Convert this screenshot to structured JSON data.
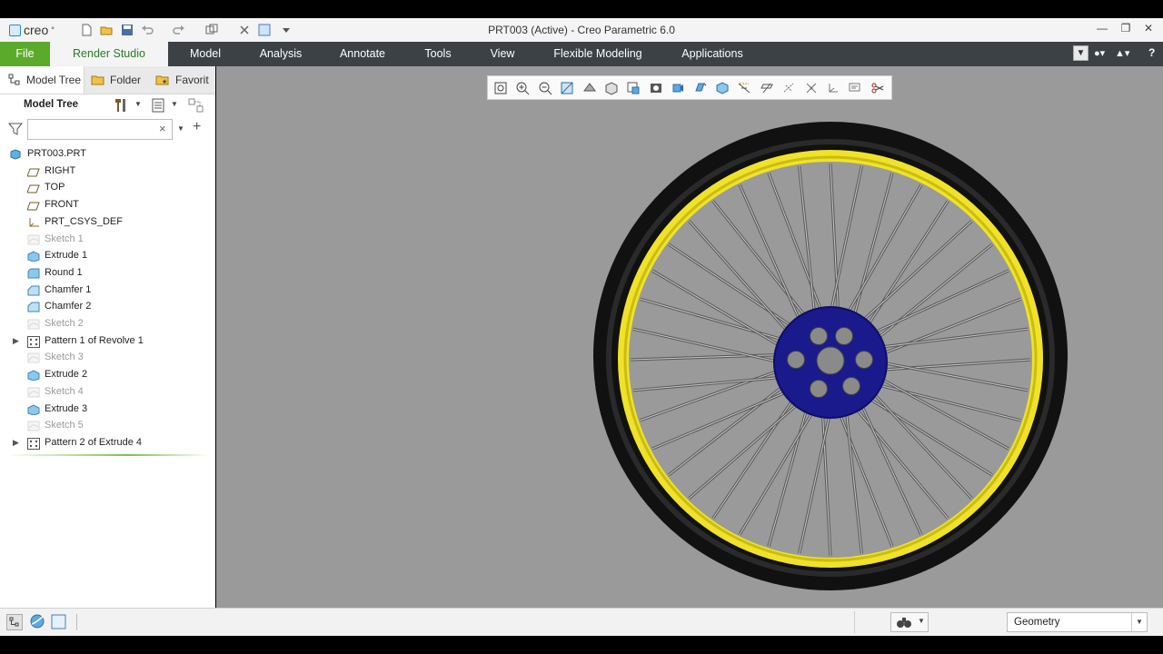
{
  "app": {
    "logo_text": "creo",
    "window_title": "PRT003 (Active) - Creo Parametric 6.0"
  },
  "ribbon": {
    "tabs": [
      "File",
      "Render Studio",
      "Model",
      "Analysis",
      "Annotate",
      "Tools",
      "View",
      "Flexible Modeling",
      "Applications"
    ]
  },
  "left_pane": {
    "tabs": [
      "Model Tree",
      "Folder",
      "Favorit"
    ],
    "header": "Model Tree",
    "search": {
      "value": "",
      "placeholder": ""
    },
    "tree": [
      {
        "label": "PRT003.PRT",
        "icon": "part-icon",
        "dim": false,
        "expandable": false,
        "root": true
      },
      {
        "label": "RIGHT",
        "icon": "datum-plane-icon",
        "dim": false,
        "expandable": false
      },
      {
        "label": "TOP",
        "icon": "datum-plane-icon",
        "dim": false,
        "expandable": false
      },
      {
        "label": "FRONT",
        "icon": "datum-plane-icon",
        "dim": false,
        "expandable": false
      },
      {
        "label": "PRT_CSYS_DEF",
        "icon": "csys-icon",
        "dim": false,
        "expandable": false
      },
      {
        "label": "Sketch 1",
        "icon": "sketch-icon",
        "dim": true,
        "expandable": false
      },
      {
        "label": "Extrude 1",
        "icon": "extrude-icon",
        "dim": false,
        "expandable": false
      },
      {
        "label": "Round 1",
        "icon": "round-icon",
        "dim": false,
        "expandable": false
      },
      {
        "label": "Chamfer 1",
        "icon": "chamfer-icon",
        "dim": false,
        "expandable": false
      },
      {
        "label": "Chamfer 2",
        "icon": "chamfer-icon",
        "dim": false,
        "expandable": false
      },
      {
        "label": "Sketch 2",
        "icon": "sketch-icon",
        "dim": true,
        "expandable": false
      },
      {
        "label": "Pattern 1 of Revolve 1",
        "icon": "pattern-icon",
        "dim": false,
        "expandable": true
      },
      {
        "label": "Sketch 3",
        "icon": "sketch-icon",
        "dim": true,
        "expandable": false
      },
      {
        "label": "Extrude 2",
        "icon": "extrude-icon",
        "dim": false,
        "expandable": false
      },
      {
        "label": "Sketch 4",
        "icon": "sketch-icon",
        "dim": true,
        "expandable": false
      },
      {
        "label": "Extrude 3",
        "icon": "extrude-icon",
        "dim": false,
        "expandable": false
      },
      {
        "label": "Sketch 5",
        "icon": "sketch-icon",
        "dim": true,
        "expandable": false
      },
      {
        "label": "Pattern 2 of Extrude 4",
        "icon": "pattern-icon",
        "dim": false,
        "expandable": true
      }
    ]
  },
  "graphics_toolbar": {
    "icons": [
      "refit-icon",
      "zoom-in-icon",
      "zoom-out-icon",
      "repaint-icon",
      "display-style-icon",
      "saved-orientations-icon",
      "view-manager-icon",
      "perspective-icon",
      "spin-center-icon",
      "named-views-icon",
      "plane-display-icon",
      "axis-display-icon",
      "point-display-icon",
      "csys-display-icon",
      "annotation-display-icon",
      "annotation-display-icon",
      "saved-views-icon",
      "section-icon"
    ]
  },
  "status_bar": {
    "filter_value": "Geometry"
  },
  "colors": {
    "file_tab": "#5caa2c",
    "ribbon": "#3c4146",
    "viewport": "#9a9a9a",
    "rim": "#f0e22a",
    "tire": "#111111",
    "hub": "#1a1a8c"
  }
}
